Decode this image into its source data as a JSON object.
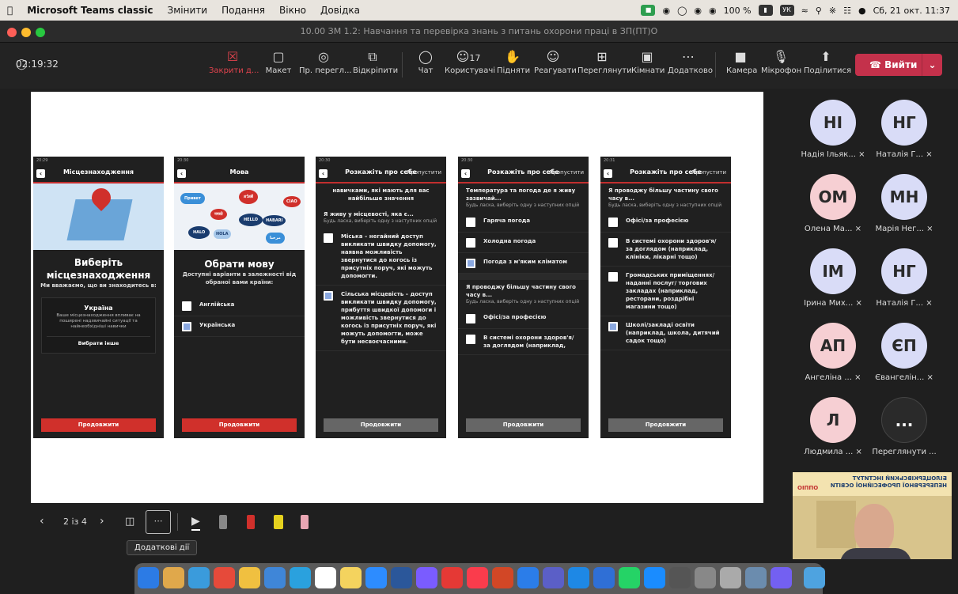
{
  "menubar": {
    "app": "Microsoft Teams classic",
    "items": [
      "Змінити",
      "Подання",
      "Вікно",
      "Довідка"
    ],
    "battery": "100 %",
    "keyboard": "УК",
    "datetime": "Сб, 21 окт.  11:37"
  },
  "window": {
    "title": "10.00 ЗМ 1.2: Навчання та перевірка знань з питань охорони праці в ЗП(ПТ)О",
    "timer": "02:19:32"
  },
  "toolbar": {
    "close_share": "Закрити д...",
    "layout": "Макет",
    "preview": "Пр. перегл...",
    "popout": "Відкріпити",
    "chat": "Чат",
    "people": "Користувачі",
    "people_count": "17",
    "raise": "Підняти",
    "react": "Реагувати",
    "view": "Переглянути",
    "rooms": "Кімнати",
    "more": "Додатково",
    "camera": "Камера",
    "mic": "Мікрофон",
    "share": "Поділитися",
    "leave": "Вийти"
  },
  "slide": {
    "p1": {
      "time": "20:29",
      "title": "Місцезнаходження",
      "heading": "Виберіть місцезнаходження",
      "sub": "Ми вважаємо, що ви знаходитесь в:",
      "country": "Україна",
      "desc": "Ваше місцезнаходження впливає на поширені надзвичайні ситуації та найнеобхідніші навички",
      "other": "Вибрати інше",
      "btn": "Продовжити"
    },
    "p2": {
      "time": "20:30",
      "title": "Мова",
      "heading": "Обрати мову",
      "sub": "Доступні варіанти в залежності від обраної вами країни:",
      "opt1": "Англійська",
      "opt2": "Українська",
      "btn": "Продовжити",
      "bubbles": [
        "Привет",
        "HALO",
        "สวัสดี",
        "CIAO",
        "HELLO",
        "नमस्ते",
        "HABARI",
        "HOLA",
        "مرحبا"
      ]
    },
    "p3": {
      "time": "20:30",
      "title": "Розкажіть про себе",
      "skip": "Пропустити",
      "top": "навичками, які мають для вас найбільше значення",
      "q": "Я живу у місцевості, яка є...",
      "qs": "Будь ласка, виберіть одну з наступних опцій",
      "opt1": "Міська – негайний доступ викликати швидку допомогу, наявна можливість звернутися до когось із присутніх поруч, які можуть допомогти.",
      "opt2": "Сільська місцевість – доступ викликати швидку допомогу, прибуття швидкої допомоги і можливість звернутися до когось із присутніх поруч, які можуть допомогти, може бути несвоєчасними.",
      "btn": "Продовжити"
    },
    "p4": {
      "time": "20:30",
      "title": "Розкажіть про себе",
      "skip": "Пропустити",
      "q": "Температура та погода де я живу зазвичай...",
      "qs": "Будь ласка, виберіть одну з наступних опцій",
      "opt1": "Гаряча погода",
      "opt2": "Холодна погода",
      "opt3": "Погода з м'яким кліматом",
      "q2": "Я проводжу більшу частину свого часу в...",
      "qs2": "Будь ласка, виберіть одну з наступних опцій",
      "opt4": "Офісі/за професією",
      "opt5": "В системі охорони здоров'я/ за доглядом (наприклад,",
      "btn": "Продовжити"
    },
    "p5": {
      "time": "20:31",
      "title": "Розкажіть про себе",
      "skip": "Пропустити",
      "q": "Я проводжу більшу частину свого часу в...",
      "qs": "Будь ласка, виберіть одну з наступних опцій",
      "opt1": "Офісі/за професією",
      "opt2": "В системі охорони здоров'я/ за доглядом (наприклад, клініки, лікарні тощо)",
      "opt3": "Громадських приміщеннях/ наданні послуг/ торгових закладах (наприклад, ресторани, роздрібні магазини тощо)",
      "opt4": "Школі/закладі освіти (наприклад, школа, дитячий садок тощо)",
      "btn": "Продовжити"
    }
  },
  "participants": [
    {
      "initials": "НІ",
      "name": "Надія Ільяк...",
      "color": "#d9dcf7"
    },
    {
      "initials": "НГ",
      "name": "Наталія Г...",
      "color": "#d9dcf7"
    },
    {
      "initials": "ОМ",
      "name": "Олена Ма...",
      "color": "#f6cfd3"
    },
    {
      "initials": "МН",
      "name": "Марія Нег...",
      "color": "#d9dcf7"
    },
    {
      "initials": "ІМ",
      "name": "Ірина Мих...",
      "color": "#d9dcf7"
    },
    {
      "initials": "НГ",
      "name": "Наталія Г...",
      "color": "#d9dcf7"
    },
    {
      "initials": "АП",
      "name": "Ангеліна ...",
      "color": "#f6cfd3"
    },
    {
      "initials": "ЄП",
      "name": "Євангелін...",
      "color": "#d9dcf7"
    },
    {
      "initials": "Л",
      "name": "Людмила ...",
      "color": "#f6cfd3"
    },
    {
      "initials": "...",
      "name": "Переглянути ...",
      "color": "#2a2a2a"
    }
  ],
  "camera": {
    "banner": "БІЛОЦЕРКІВСЬКИЙ ІНСТИТУТ НЕПЕРЕРВНОЇ ПРОФЕСІЙНОЇ ОСВІТИ",
    "logo": "ОІППО"
  },
  "presenter": {
    "page": "2 із 4",
    "tooltip": "Додаткові дії"
  },
  "colors": {
    "accent_red": "#c4314b",
    "phone_red": "#d0302b",
    "check_blue": "#8aa8e0"
  }
}
